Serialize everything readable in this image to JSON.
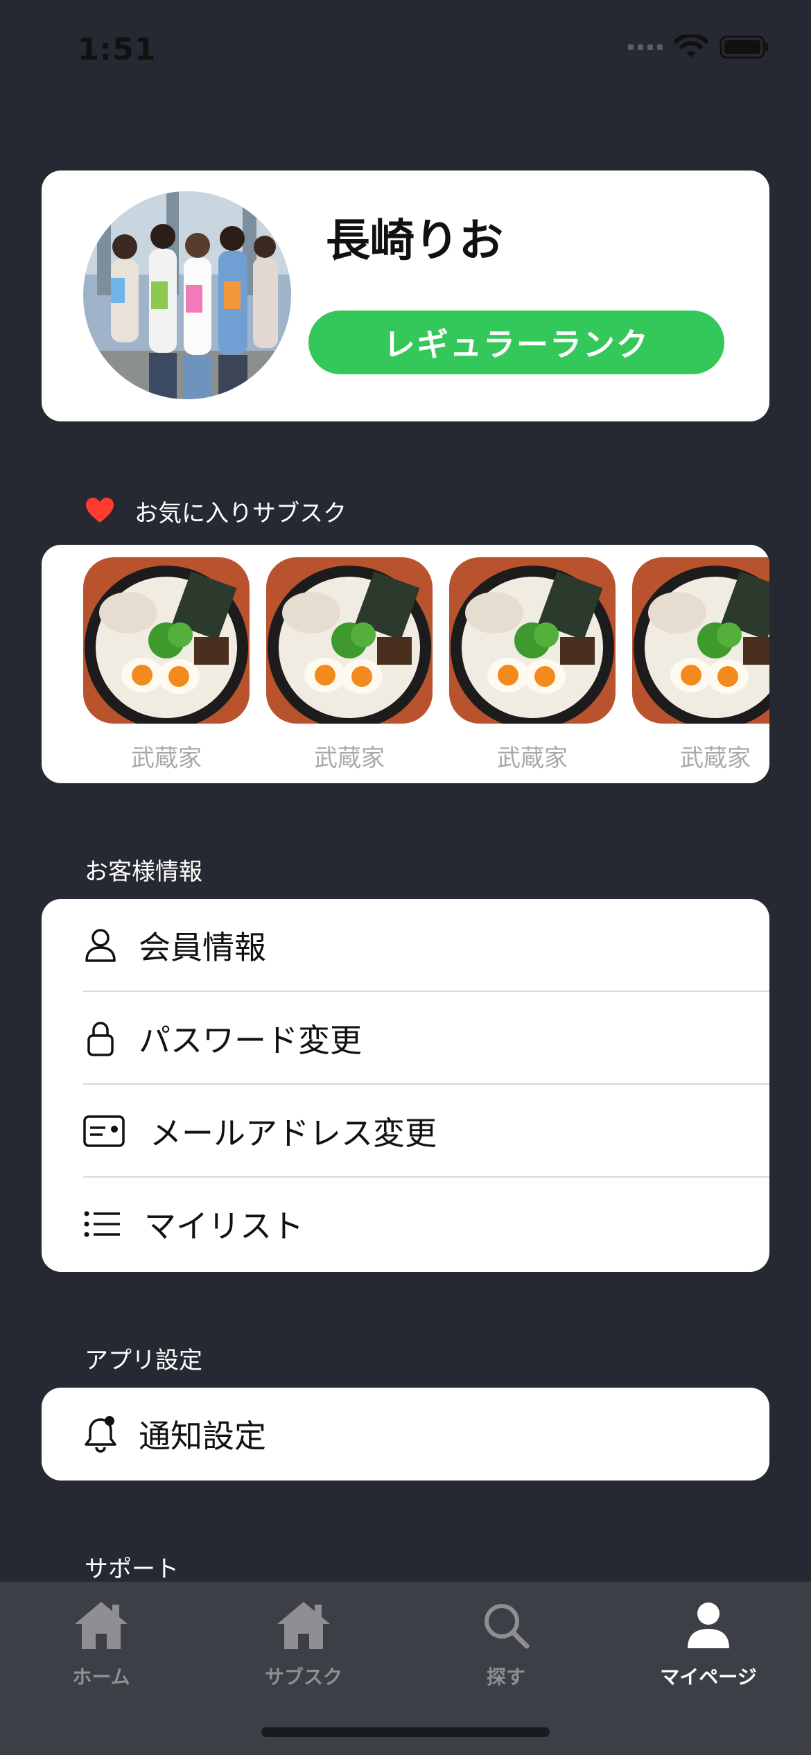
{
  "status_bar": {
    "time": "1:51"
  },
  "profile": {
    "name": "長崎りお",
    "rank_label": "レギュラーランク"
  },
  "favorites": {
    "title": "お気に入りサブスク",
    "items": [
      {
        "label": "武蔵家"
      },
      {
        "label": "武蔵家"
      },
      {
        "label": "武蔵家"
      },
      {
        "label": "武蔵家"
      }
    ]
  },
  "customer_info": {
    "title": "お客様情報",
    "items": [
      {
        "label": "会員情報",
        "icon": "person-icon"
      },
      {
        "label": "パスワード変更",
        "icon": "lock-icon"
      },
      {
        "label": "メールアドレス変更",
        "icon": "id-card-icon"
      },
      {
        "label": "マイリスト",
        "icon": "list-icon"
      }
    ]
  },
  "app_settings": {
    "title": "アプリ設定",
    "items": [
      {
        "label": "通知設定",
        "icon": "bell-badge-icon"
      }
    ]
  },
  "support": {
    "title": "サポート"
  },
  "tab_bar": {
    "tabs": [
      {
        "label": "ホーム",
        "icon": "house-icon"
      },
      {
        "label": "サブスク",
        "icon": "house-icon"
      },
      {
        "label": "探す",
        "icon": "magnifier-icon"
      },
      {
        "label": "マイページ",
        "icon": "person-fill-icon"
      }
    ],
    "active_index": 3
  },
  "colors": {
    "background": "#262932",
    "accent_green": "#34c759",
    "heart_red": "#ff3b30",
    "tab_bar": "#3d3f47"
  }
}
